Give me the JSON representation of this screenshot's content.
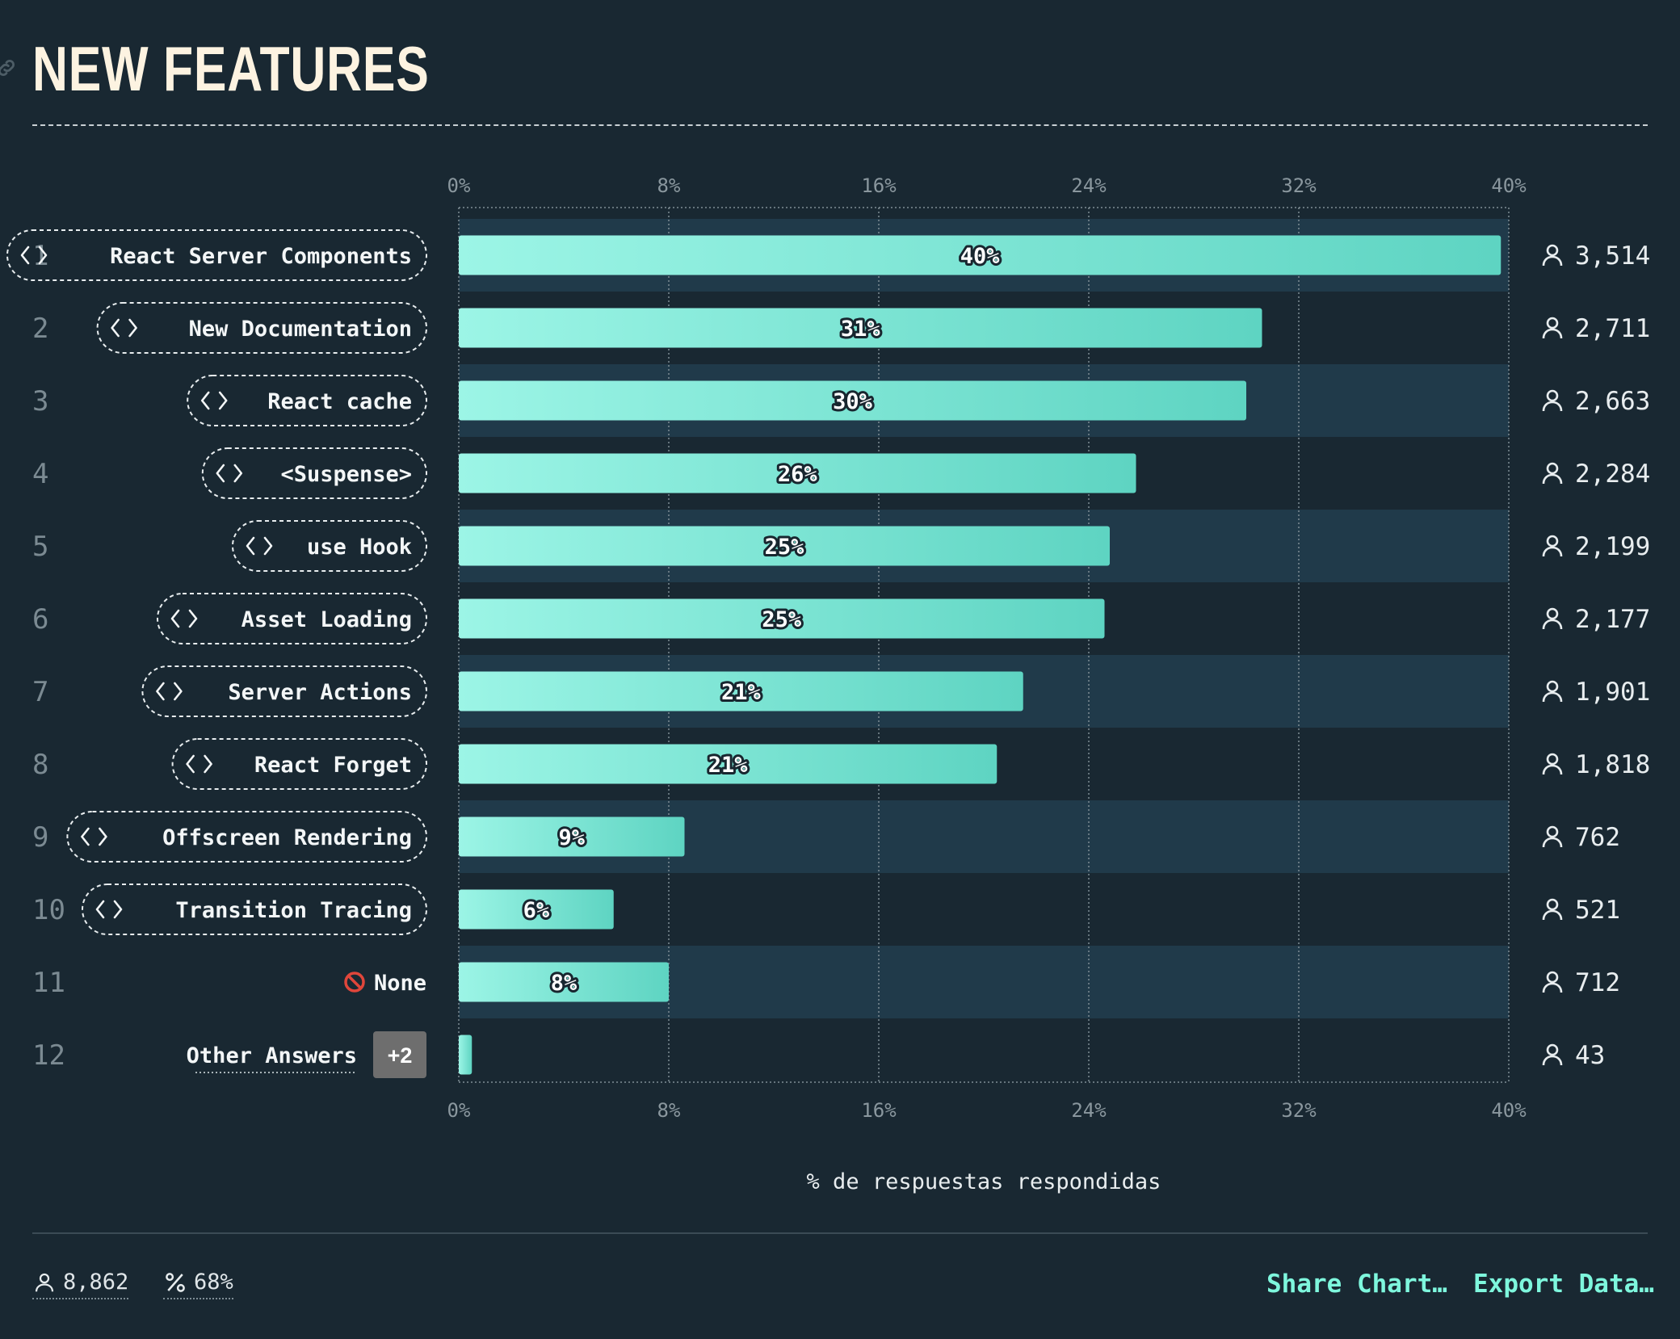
{
  "title": "NEW FEATURES",
  "icons": {
    "title_link": "link-icon",
    "respondents": "user-icon",
    "percent": "percent-icon",
    "item": "code-icon",
    "none": "no-entry-icon"
  },
  "colors": {
    "background": "#192832",
    "band": "#203a4a",
    "bar_start": "#9cf5e6",
    "bar_end": "#5ed4c2",
    "accent": "#7ef7dd"
  },
  "chart_data": {
    "type": "bar",
    "orientation": "horizontal",
    "categories": [
      "React Server Components",
      "New Documentation",
      "React cache",
      "<Suspense>",
      "use Hook",
      "Asset Loading",
      "Server Actions",
      "React Forget",
      "Offscreen Rendering",
      "Transition Tracing",
      "None",
      "Other Answers"
    ],
    "ranks": [
      "1",
      "2",
      "3",
      "4",
      "5",
      "6",
      "7",
      "8",
      "9",
      "10",
      "11",
      "12"
    ],
    "values": [
      39.7,
      30.6,
      30.0,
      25.8,
      24.8,
      24.6,
      21.5,
      20.5,
      8.6,
      5.9,
      8.0,
      0.5
    ],
    "value_labels": [
      "40%",
      "31%",
      "30%",
      "26%",
      "25%",
      "25%",
      "21%",
      "21%",
      "9%",
      "6%",
      "8%",
      ""
    ],
    "counts": [
      "3,514",
      "2,711",
      "2,663",
      "2,284",
      "2,199",
      "2,177",
      "1,901",
      "1,818",
      "762",
      "521",
      "712",
      "43"
    ],
    "x_ticks": [
      "0%",
      "8%",
      "16%",
      "24%",
      "32%",
      "40%"
    ],
    "xlim": [
      0,
      40
    ],
    "xlabel": "% de respuestas respondidas",
    "other_badge": "+2",
    "grid": true
  },
  "footer": {
    "respondents": "8,862",
    "completion": "68%",
    "share": "Share Chart…",
    "export": "Export Data…"
  }
}
